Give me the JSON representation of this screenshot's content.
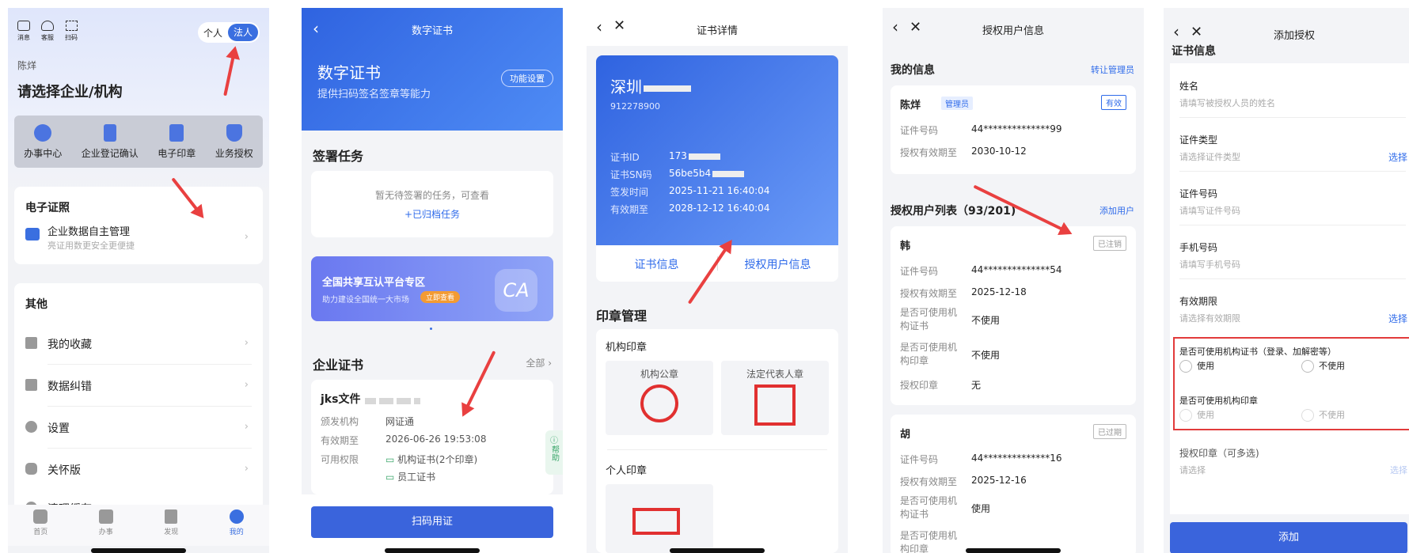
{
  "p1": {
    "top_icons": [
      "消息",
      "客服",
      "扫码"
    ],
    "toggle_personal": "个人",
    "toggle_legal": "法人",
    "user": "陈烊",
    "heading": "请选择企业/机构",
    "quick": [
      "办事中心",
      "企业登记确认",
      "电子印章",
      "业务授权"
    ],
    "ecert_title": "电子证照",
    "ecert_item": "企业数据自主管理",
    "ecert_sub": "亮证用数更安全更便捷",
    "other_title": "其他",
    "menu": [
      "我的收藏",
      "数据纠错",
      "设置",
      "关怀版",
      "清理缓存"
    ],
    "tabs": [
      "首页",
      "办事",
      "发现",
      "我的"
    ]
  },
  "p2": {
    "nav": "数字证书",
    "title": "数字证书",
    "sub": "提供扫码签名签章等能力",
    "func_btn": "功能设置",
    "sign_title": "签署任务",
    "sign_empty": "暂无待签署的任务，可查看",
    "sign_link": "+已归档任务",
    "banner_title": "全国共享互认平台专区",
    "banner_sub": "助力建设全国统一大市场",
    "banner_btn": "立即查看",
    "banner_ca": "CA",
    "ent_title": "企业证书",
    "ent_all": "全部 ›",
    "cert_name": "jks文件",
    "rows": [
      {
        "k": "颁发机构",
        "v": "网证通"
      },
      {
        "k": "有效期至",
        "v": "2026-06-26 19:53:08"
      },
      {
        "k": "可用权限",
        "v": "机构证书(2个印章)"
      }
    ],
    "perm2": "员工证书",
    "help": "帮助",
    "scan_btn": "扫码用证"
  },
  "p3": {
    "nav": "证书详情",
    "org": "深圳",
    "code": "912278900",
    "rows": [
      {
        "k": "证书ID",
        "v": "173"
      },
      {
        "k": "证书SN码",
        "v": "56be5b4"
      },
      {
        "k": "签发时间",
        "v": "2025-11-21 16:40:04"
      },
      {
        "k": "有效期至",
        "v": "2028-12-12 16:40:04"
      }
    ],
    "tab1": "证书信息",
    "tab2": "授权用户信息",
    "seal_title": "印章管理",
    "org_seal": "机构印章",
    "seal1": "机构公章",
    "seal2": "法定代表人章",
    "personal_seal": "个人印章"
  },
  "p4": {
    "nav": "授权用户信息",
    "my_info": "我的信息",
    "transfer": "转让管理员",
    "me": {
      "name": "陈烊",
      "role": "管理员",
      "status": "有效",
      "rows": [
        {
          "k": "证件号码",
          "v": "44**************99"
        },
        {
          "k": "授权有效期至",
          "v": "2030-10-12"
        }
      ]
    },
    "list_title": "授权用户列表（93/201)",
    "add_user": "添加用户",
    "users": [
      {
        "name": "韩",
        "status": "已注销",
        "rows": [
          {
            "k": "证件号码",
            "v": "44**************54"
          },
          {
            "k": "授权有效期至",
            "v": "2025-12-18"
          },
          {
            "k": "是否可使用机构证书",
            "v": "不使用"
          },
          {
            "k": "是否可使用机构印章",
            "v": "不使用"
          },
          {
            "k": "授权印章",
            "v": "无"
          }
        ]
      },
      {
        "name": "胡",
        "status": "已过期",
        "rows": [
          {
            "k": "证件号码",
            "v": "44**************16"
          },
          {
            "k": "授权有效期至",
            "v": "2025-12-16"
          },
          {
            "k": "是否可使用机构证书",
            "v": "使用"
          },
          {
            "k": "是否可使用机构印章",
            "v": ""
          }
        ]
      }
    ]
  },
  "p5": {
    "nav": "添加授权",
    "section": "证书信息",
    "fields": [
      {
        "label": "姓名",
        "ph": "请填写被授权人员的姓名",
        "select": ""
      },
      {
        "label": "证件类型",
        "ph": "请选择证件类型",
        "select": "选择"
      },
      {
        "label": "证件号码",
        "ph": "请填写证件号码",
        "select": ""
      },
      {
        "label": "手机号码",
        "ph": "请填写手机号码",
        "select": ""
      },
      {
        "label": "有效期限",
        "ph": "请选择有效期限",
        "select": "选择"
      }
    ],
    "q1": "是否可使用机构证书（登录、加解密等）",
    "q2": "是否可使用机构印章",
    "use": "使用",
    "nouse": "不使用",
    "seal_label": "授权印章（可多选)",
    "seal_ph": "请选择",
    "seal_select": "选择",
    "add_btn": "添加"
  }
}
